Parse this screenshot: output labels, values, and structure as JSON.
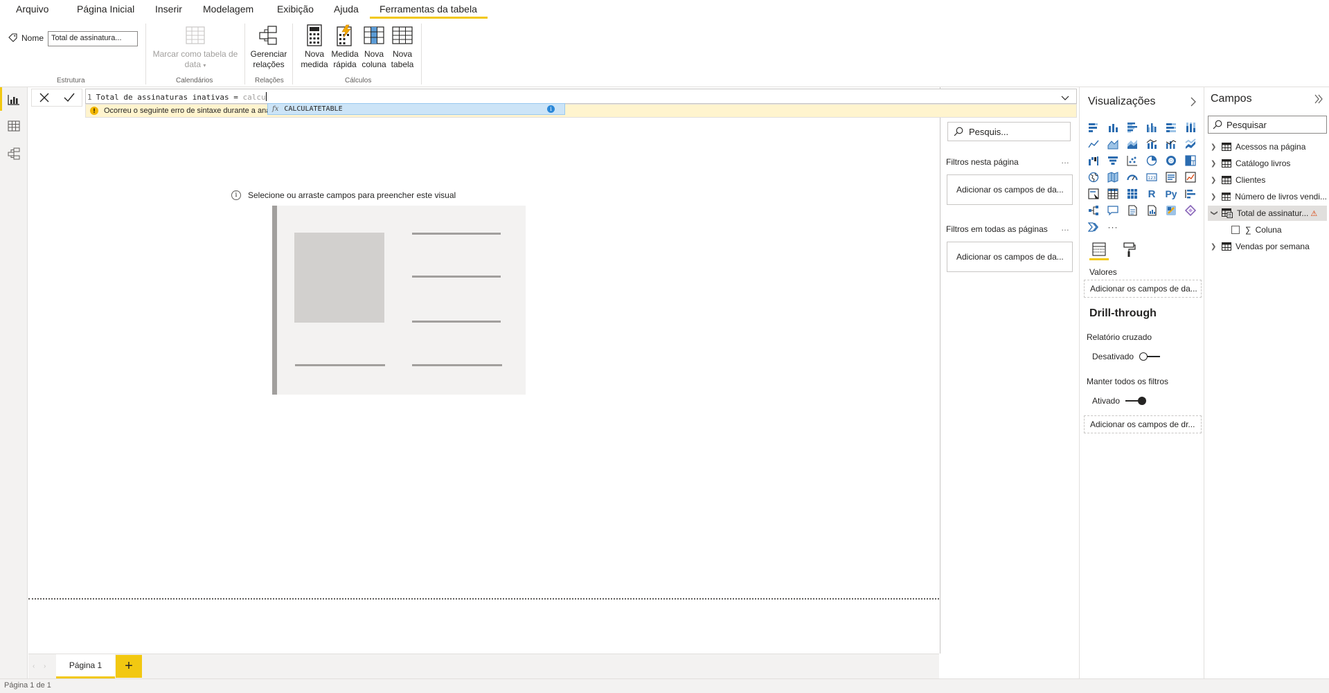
{
  "menu": {
    "items": [
      "Arquivo",
      "Página Inicial",
      "Inserir",
      "Modelagem",
      "Exibição",
      "Ajuda",
      "Ferramentas da tabela"
    ],
    "active_index": 6
  },
  "ribbon": {
    "name_label": "Nome",
    "name_value": "Total de assinatura...",
    "structure_label": "Estrutura",
    "mark_date_line1": "Marcar como tabela de",
    "mark_date_line2": "data",
    "calendars_label": "Calendários",
    "manage_rel_line1": "Gerenciar",
    "manage_rel_line2": "relações",
    "relations_label": "Relações",
    "new_measure_line1": "Nova",
    "new_measure_line2": "medida",
    "quick_measure_line1": "Medida",
    "quick_measure_line2": "rápida",
    "new_column_line1": "Nova",
    "new_column_line2": "coluna",
    "new_table_line1": "Nova",
    "new_table_line2": "tabela",
    "calculations_label": "Cálculos"
  },
  "formula": {
    "line_number": "1",
    "code": "Total de assinaturas inativas = ",
    "typed": "calcu",
    "error": "Ocorreu o seguinte erro de sintaxe durante a análise: Token Inválido, Linha 1, Deslocamento 43, …",
    "autocomplete": "CALCULATETABLE",
    "fx": "fx",
    "info_glyph": "i"
  },
  "canvas": {
    "hint": "Selecione ou arraste campos para preencher este visual",
    "hint_glyph": "i"
  },
  "pages": {
    "tab": "Página 1",
    "add": "+",
    "prev": "‹",
    "next": "›",
    "status": "Página 1 de 1"
  },
  "filters": {
    "search_placeholder": "Pesquis...",
    "on_page_title": "Filtros nesta página",
    "on_page_well": "Adicionar os campos de da...",
    "all_pages_title": "Filtros em todas as páginas",
    "all_pages_well": "Adicionar os campos de da...",
    "more": "…"
  },
  "visualizations": {
    "title": "Visualizações",
    "more_visuals": "···",
    "values_label": "Valores",
    "values_well": "Adicionar os campos de da...",
    "drill_title": "Drill-through",
    "cross_report_label": "Relatório cruzado",
    "cross_report_state": "Desativado",
    "cross_report_on": false,
    "keep_filters_label": "Manter todos os filtros",
    "keep_filters_state": "Ativado",
    "keep_filters_on": true,
    "drill_well": "Adicionar os campos de dr...",
    "r_glyph": "R",
    "py_glyph": "Py"
  },
  "fields": {
    "title": "Campos",
    "search_placeholder": "Pesquisar",
    "tables": [
      {
        "name": "Acessos na página",
        "expanded": false
      },
      {
        "name": "Catálogo livros",
        "expanded": false
      },
      {
        "name": "Clientes",
        "expanded": false
      },
      {
        "name": "Número de livros vendi...",
        "expanded": false
      },
      {
        "name": "Total de assinatur...",
        "expanded": true,
        "warning": true
      },
      {
        "name": "Vendas por semana",
        "expanded": false
      }
    ],
    "column_name": "Coluna",
    "sigma": "∑",
    "warn_glyph": "⚠"
  },
  "colors": {
    "accent": "#f2c811",
    "viz_blue": "#2b6cb0",
    "warning_bg": "#fff4ce",
    "autocomplete_bg": "#cce4f7"
  }
}
